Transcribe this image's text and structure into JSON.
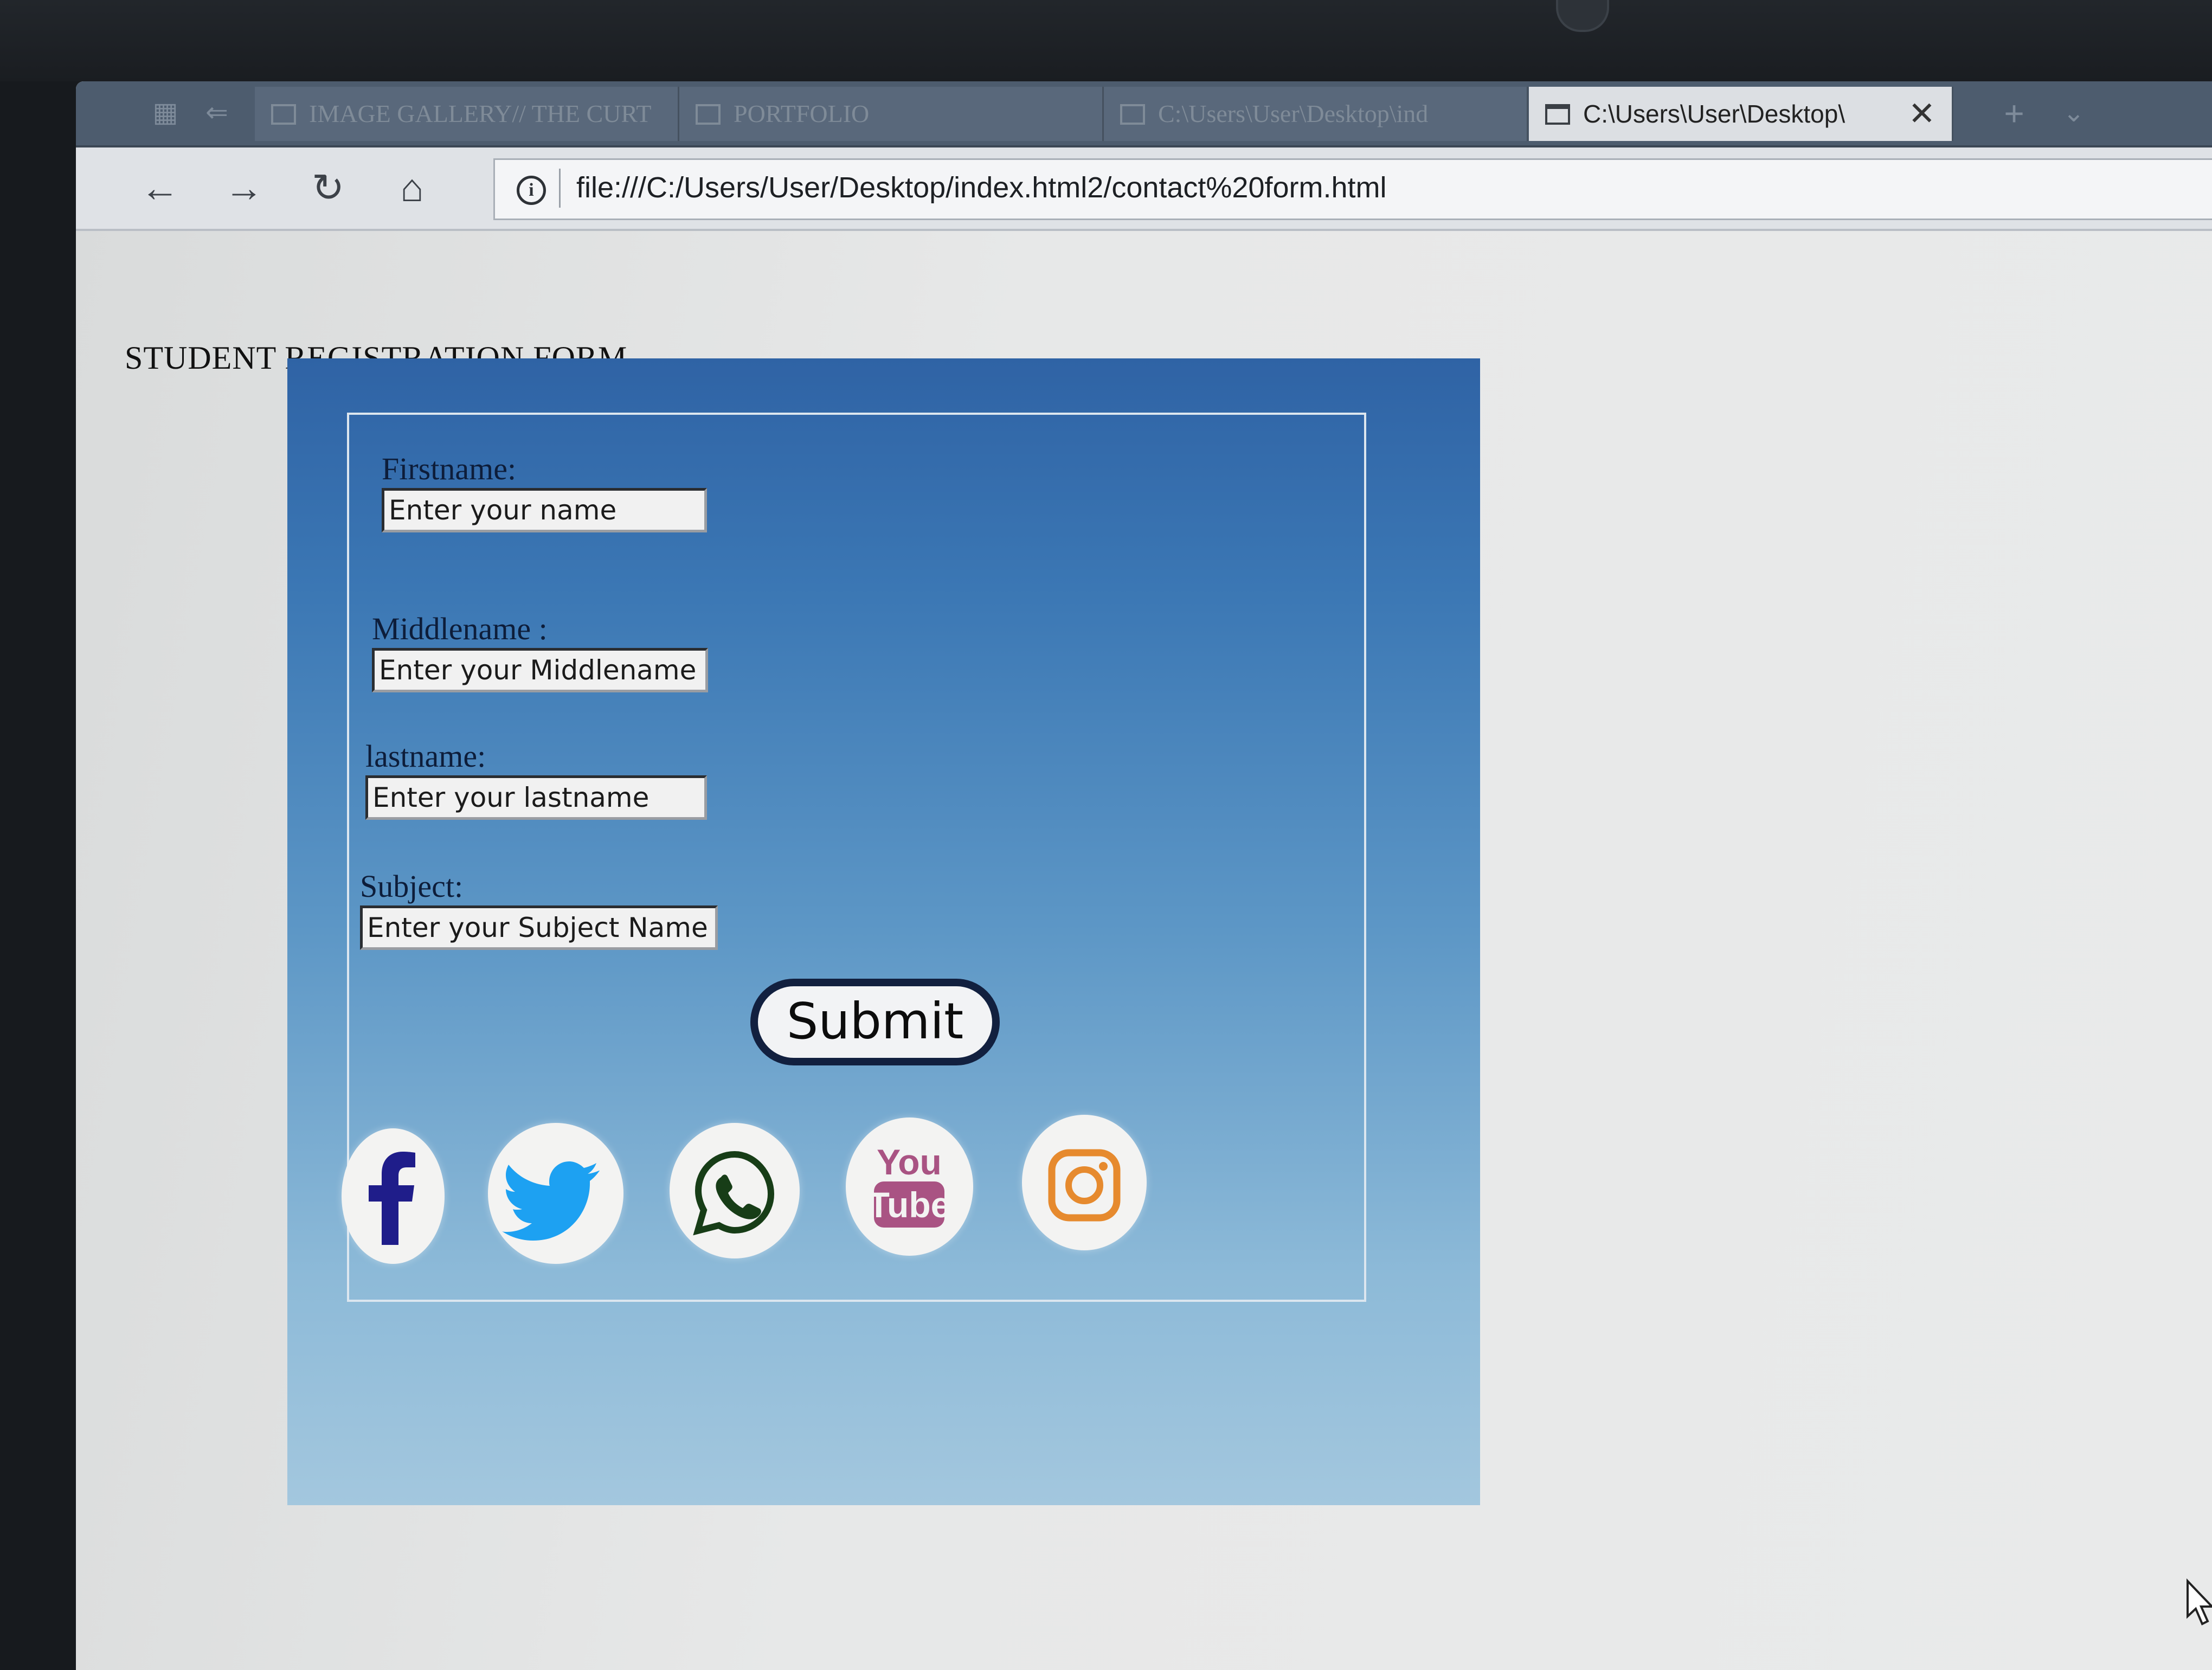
{
  "browser": {
    "tabs": [
      {
        "title": "IMAGE GALLERY// THE CURT",
        "active": false
      },
      {
        "title": "PORTFOLIO",
        "active": false
      },
      {
        "title": "C:\\Users\\User\\Desktop\\ind",
        "active": false
      },
      {
        "title": "C:\\Users\\User\\Desktop\\",
        "active": true
      }
    ],
    "address": "file:///C:/Users/User/Desktop/index.html2/contact%20form.html",
    "nav_icons": [
      "back-arrow-icon",
      "forward-arrow-icon",
      "refresh-icon",
      "home-icon",
      "info-icon"
    ]
  },
  "page": {
    "heading": "STUDENT REGISTRATION FORM",
    "form": {
      "firstname": {
        "label": "Firstname:",
        "placeholder": "Enter your name"
      },
      "middlename": {
        "label": "Middlename :",
        "placeholder": "Enter your Middlename"
      },
      "lastname": {
        "label": "lastname:",
        "placeholder": "Enter your lastname"
      },
      "subject": {
        "label": "Subject:",
        "placeholder": "Enter your Subject Name"
      },
      "submit_label": "Submit"
    },
    "social_icons": [
      {
        "name": "facebook-icon",
        "color": "#1f1d8a"
      },
      {
        "name": "twitter-icon",
        "color": "#1da1f2"
      },
      {
        "name": "whatsapp-icon",
        "color": "#173d17"
      },
      {
        "name": "youtube-icon",
        "text_top": "You",
        "text_bottom": "Tube",
        "color": "#a95383"
      },
      {
        "name": "instagram-icon",
        "color": "#e68a2e"
      }
    ],
    "colors": {
      "panel_top": "#2f63a5",
      "panel_bottom": "#a3c7de",
      "submit_border": "#12203f"
    }
  }
}
